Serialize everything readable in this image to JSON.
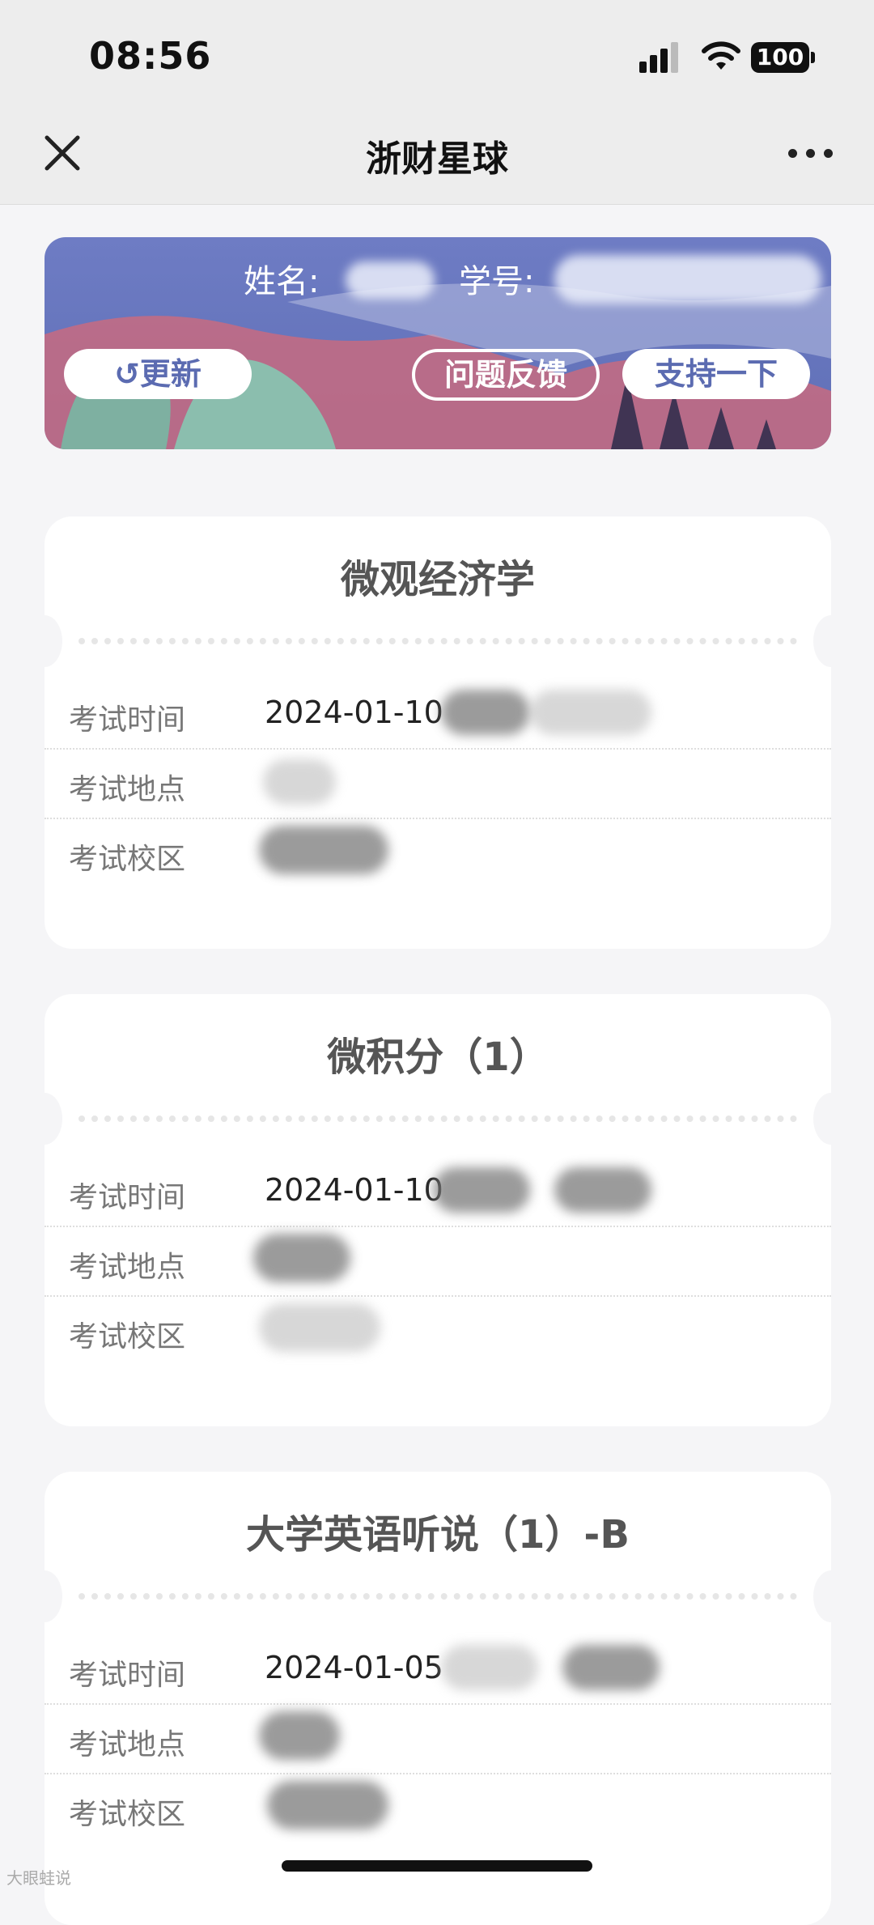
{
  "status_bar": {
    "time": "08:56",
    "battery": "100"
  },
  "nav": {
    "title": "浙财星球"
  },
  "banner": {
    "name_label": "姓名:",
    "id_label": "学号:",
    "refresh_label": "↺更新",
    "feedback_label": "问题反馈",
    "support_label": "支持一下"
  },
  "exams": [
    {
      "course": "微观经济学",
      "time_label": "考试时间",
      "time_value": "2024-01-10",
      "place_label": "考试地点",
      "campus_label": "考试校区"
    },
    {
      "course": "微积分（1）",
      "time_label": "考试时间",
      "time_value": "2024-01-10",
      "place_label": "考试地点",
      "campus_label": "考试校区"
    },
    {
      "course": "大学英语听说（1）-B",
      "time_label": "考试时间",
      "time_value": "2024-01-05",
      "place_label": "考试地点",
      "campus_label": "考试校区"
    }
  ],
  "watermark": "大眼蛙说"
}
